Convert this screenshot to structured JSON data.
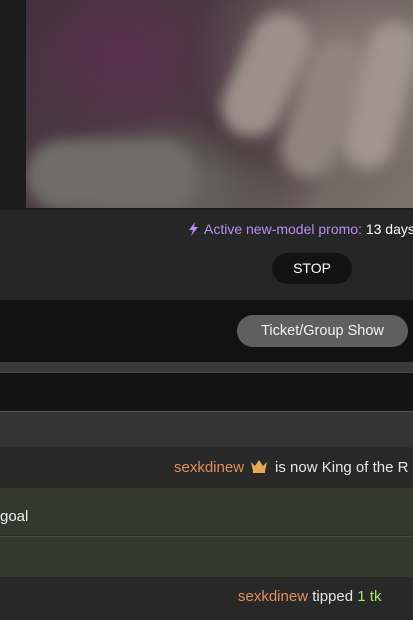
{
  "promo": {
    "label": "Active new-model promo:",
    "value": "13 days"
  },
  "controls": {
    "stop_label": "STOP",
    "ticket_label": "Ticket/Group Show"
  },
  "chat": {
    "king_message": {
      "username": "sexkdinew",
      "text": "is now King of the R"
    },
    "goal_message": {
      "text": "goal"
    },
    "tip_message": {
      "username": "sexkdinew",
      "text": "tipped",
      "amount": "1 tk"
    }
  },
  "icons": {
    "promo": "lightning-bolt-icon",
    "king": "crown-icon"
  },
  "colors": {
    "promo_label": "#b88ef0",
    "username": "#e0905a",
    "tip_amount": "#a9e36b",
    "crown": "#e8a85a"
  }
}
